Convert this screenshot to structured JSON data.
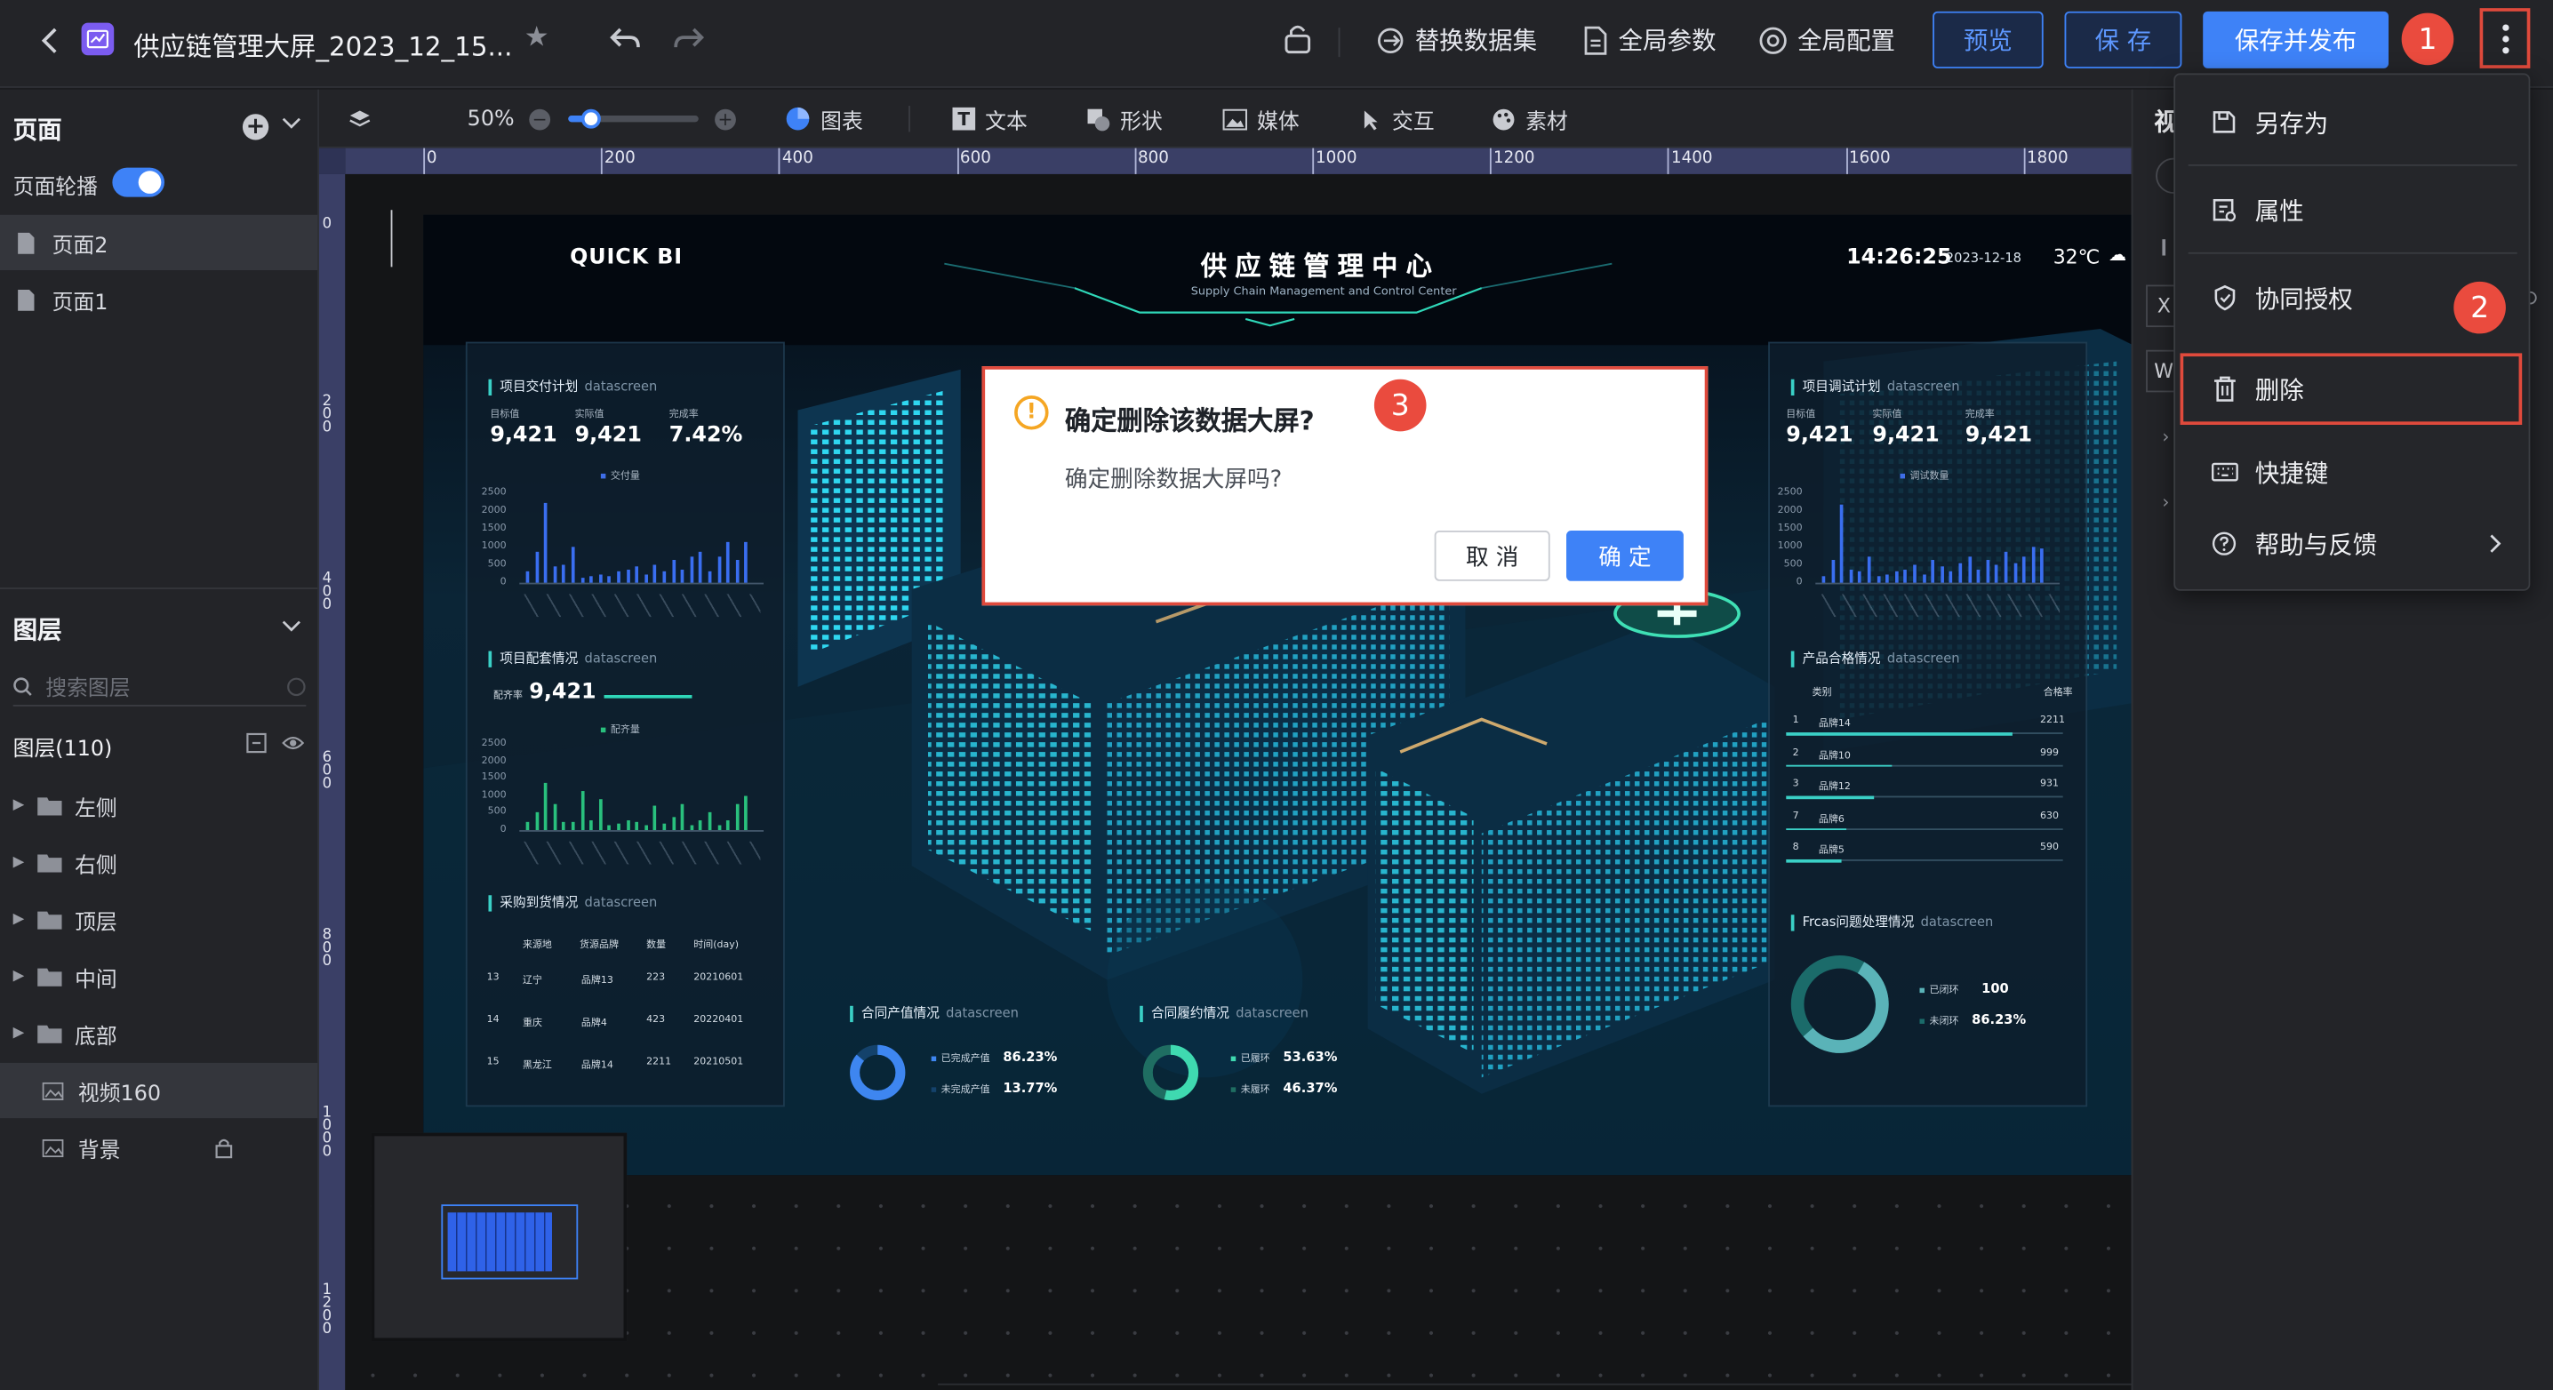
{
  "header": {
    "title": "供应链管理大屏_2023_12_15...",
    "actions": [
      "替换数据集",
      "全局参数",
      "全局配置"
    ],
    "preview_label": "预览",
    "save_label": "保 存",
    "save_publish_label": "保存并发布"
  },
  "toolbar": {
    "zoom": "50%",
    "zoom_level": 0.1,
    "tools": [
      "图表",
      "文本",
      "形状",
      "媒体",
      "交互",
      "素材"
    ]
  },
  "pages": {
    "title": "页面",
    "carousel_label": "页面轮播",
    "carousel_on": true,
    "items": [
      "页面2",
      "页面1"
    ]
  },
  "layers": {
    "title": "图层",
    "search_placeholder": "搜索图层",
    "count_label": "图层(110)",
    "groups": [
      "左侧",
      "右侧",
      "顶层",
      "中间",
      "底部"
    ],
    "items": [
      "视频160",
      "背景"
    ]
  },
  "rulers": {
    "h": [
      "0",
      "200",
      "400",
      "600",
      "800",
      "1000",
      "1200",
      "1400",
      "1600",
      "1800"
    ],
    "v": [
      "0",
      "200",
      "400",
      "600",
      "800",
      "1000",
      "1200"
    ]
  },
  "dashboard": {
    "brand": "QUICK BI",
    "title": "供应链管理中心",
    "subtitle": "Supply Chain Management and Control Center",
    "time": "14:26:25",
    "date": "2023-12-18",
    "temp": "32℃",
    "panel_sub": "datascreen",
    "left1": {
      "title": "项目交付计划",
      "kpis": [
        {
          "label": "目标值",
          "value": "9,421"
        },
        {
          "label": "实际值",
          "value": "9,421"
        },
        {
          "label": "完成率",
          "value": "7.42%"
        }
      ],
      "legend": "交付量",
      "yticks": [
        "2500",
        "2000",
        "1500",
        "1000",
        "500",
        "0"
      ]
    },
    "left2": {
      "title": "项目配套情况",
      "kpi_label": "配齐率",
      "kpi_value": "9,421",
      "legend": "配齐量",
      "yticks": [
        "2500",
        "2000",
        "1500",
        "1000",
        "500",
        "0"
      ]
    },
    "left3": {
      "title": "采购到货情况",
      "headers": [
        "来源地",
        "货源品牌",
        "数量",
        "时间(day)"
      ],
      "rows": [
        [
          "13",
          "辽宁",
          "品牌13",
          "223",
          "20210601"
        ],
        [
          "14",
          "重庆",
          "品牌4",
          "423",
          "20220401"
        ],
        [
          "15",
          "黑龙江",
          "品牌14",
          "2211",
          "20210501"
        ]
      ]
    },
    "bottom1": {
      "title": "合同产值情况",
      "rows": [
        {
          "label": "已完成产值",
          "value": "86.23%"
        },
        {
          "label": "未完成产值",
          "value": "13.77%"
        }
      ]
    },
    "bottom2": {
      "title": "合同履约情况",
      "rows": [
        {
          "label": "已履环",
          "value": "53.63%"
        },
        {
          "label": "未履环",
          "value": "46.37%"
        }
      ]
    },
    "right1": {
      "title": "项目调试计划",
      "kpis": [
        {
          "label": "目标值",
          "value": "9,421"
        },
        {
          "label": "实际值",
          "value": "9,421"
        },
        {
          "label": "完成率",
          "value": "9,421"
        }
      ],
      "legend": "调试数量",
      "yticks": [
        "2500",
        "2000",
        "1500",
        "1000",
        "500",
        "0"
      ]
    },
    "right2": {
      "title": "产品合格情况",
      "headers": [
        "类别",
        "合格率"
      ],
      "rows": [
        [
          "1",
          "品牌14",
          "2211"
        ],
        [
          "2",
          "品牌10",
          "999"
        ],
        [
          "3",
          "品牌12",
          "931"
        ],
        [
          "7",
          "品牌6",
          "630"
        ],
        [
          "8",
          "品牌5",
          "590"
        ]
      ]
    },
    "right3": {
      "title": "Frcas问题处理情况",
      "rows": [
        {
          "label": "已闭环",
          "value": "100"
        },
        {
          "label": "未闭环",
          "value": "86.23%"
        }
      ]
    }
  },
  "menu": {
    "items": [
      "另存为",
      "属性",
      "协同授权",
      "删除",
      "快捷键",
      "帮助与反馈"
    ]
  },
  "dialog": {
    "title": "确定删除该数据大屏?",
    "message": "确定删除数据大屏吗?",
    "cancel_label": "取 消",
    "confirm_label": "确 定"
  },
  "right_panel": {
    "title_fragment": "视",
    "field_x": "X",
    "field_w": "W"
  },
  "badges": [
    "1",
    "2",
    "3"
  ],
  "colors": {
    "primary": "#3e82f7",
    "highlight_border": "#e04a3c",
    "badge": "#ea4b3e",
    "warning": "#f5a623"
  }
}
